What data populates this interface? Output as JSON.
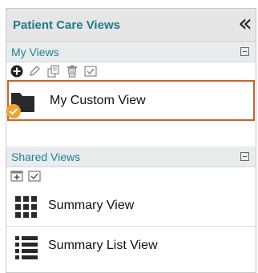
{
  "panel": {
    "title": "Patient Care Views",
    "collapse_icon": "double-chevron-left-icon"
  },
  "my_views": {
    "header": "My Views",
    "toolbar": [
      "add-icon",
      "edit-icon",
      "copy-icon",
      "delete-icon",
      "check-icon"
    ],
    "items": [
      {
        "label": "My Custom View",
        "icon": "folder-icon",
        "selected": true
      }
    ]
  },
  "shared_views": {
    "header": "Shared Views",
    "toolbar": [
      "add-box-icon",
      "check-icon"
    ],
    "items": [
      {
        "label": "Summary View",
        "icon": "grid-icon"
      },
      {
        "label": "Summary List View",
        "icon": "list-icon"
      }
    ]
  },
  "colors": {
    "accent": "#1d7a8a",
    "selection_border": "#c7622e",
    "check_badge": "#f0a330"
  }
}
